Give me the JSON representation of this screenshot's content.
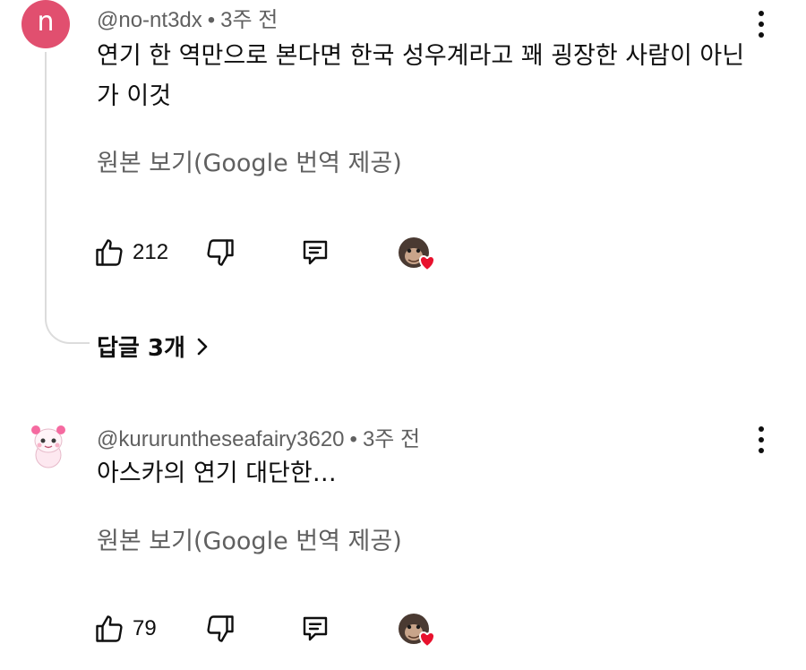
{
  "comments": [
    {
      "avatar_letter": "n",
      "avatar_color": "#e14f6f",
      "handle": "@no-nt3dx",
      "time": "3주 전",
      "text": "연기 한 역만으로 본다면 한국 성우계라고 꽤 굉장한 사람이 아닌가 이것",
      "translate_link": "원본 보기(Google 번역 제공)",
      "likes": "212",
      "replies_label": "답글 3개"
    },
    {
      "handle": "@kururuntheseafairy3620",
      "time": "3주 전",
      "text": "아스카의 연기 대단한…",
      "translate_link": "원본 보기(Google 번역 제공)",
      "likes": "79"
    }
  ],
  "separator": "•",
  "icons": {
    "like": "thumb-up-icon",
    "dislike": "thumb-down-icon",
    "reply": "comment-reply-icon",
    "more": "more-vert-icon",
    "creator_heart": "creator-heart-icon",
    "replies_chevron": "chevron-right-icon"
  },
  "colors": {
    "text": "#0f0f0f",
    "secondary": "#606060",
    "heart": "#e8112d"
  }
}
